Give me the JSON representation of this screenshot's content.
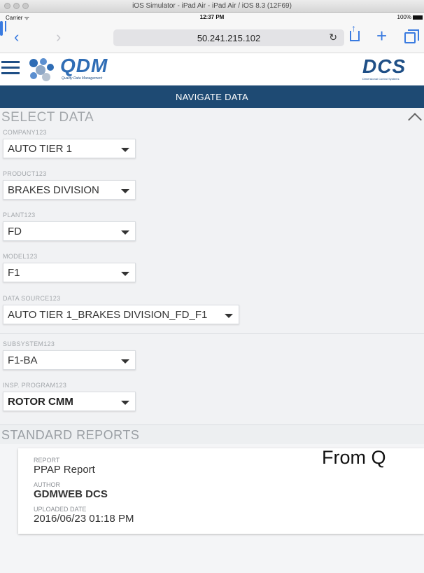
{
  "simulator": {
    "title": "iOS Simulator - iPad Air - iPad Air / iOS 8.3 (12F69)"
  },
  "status_bar": {
    "carrier": "Carrier ᯤ",
    "time": "12:37 PM",
    "battery": "100%"
  },
  "browser": {
    "url": "50.241.215.102",
    "reload_glyph": "↻",
    "back_glyph": "‹",
    "forward_glyph": "›",
    "add_glyph": "+"
  },
  "app": {
    "logo_text": "QDM",
    "logo_tagline": "Quality Data Management",
    "partner_logo_text": "DCS",
    "partner_tagline": "Dimensional Control Systems"
  },
  "navigate": {
    "title": "NAVIGATE DATA"
  },
  "select_data": {
    "title": "SELECT DATA",
    "fields": [
      {
        "label": "COMPANY123",
        "value": "AUTO TIER 1"
      },
      {
        "label": "PRODUCT123",
        "value": "BRAKES DIVISION"
      },
      {
        "label": "PLANT123",
        "value": "FD"
      },
      {
        "label": "MODEL123",
        "value": "F1"
      },
      {
        "label": "DATA SOURCE123",
        "value": "AUTO TIER 1_BRAKES DIVISION_FD_F1"
      },
      {
        "label": "SUBSYSTEM123",
        "value": "F1-BA"
      },
      {
        "label": "INSP. PROGRAM123",
        "value": "ROTOR CMM"
      }
    ]
  },
  "standard_reports": {
    "title": "STANDARD REPORTS",
    "report": {
      "report_label": "REPORT",
      "report_value": "PPAP Report",
      "author_label": "AUTHOR",
      "author_value": "GDMWEB DCS",
      "date_label": "UPLOADED DATE",
      "date_value": "2016/06/23 01:18 PM"
    }
  },
  "overlay": {
    "text": "From Q"
  }
}
